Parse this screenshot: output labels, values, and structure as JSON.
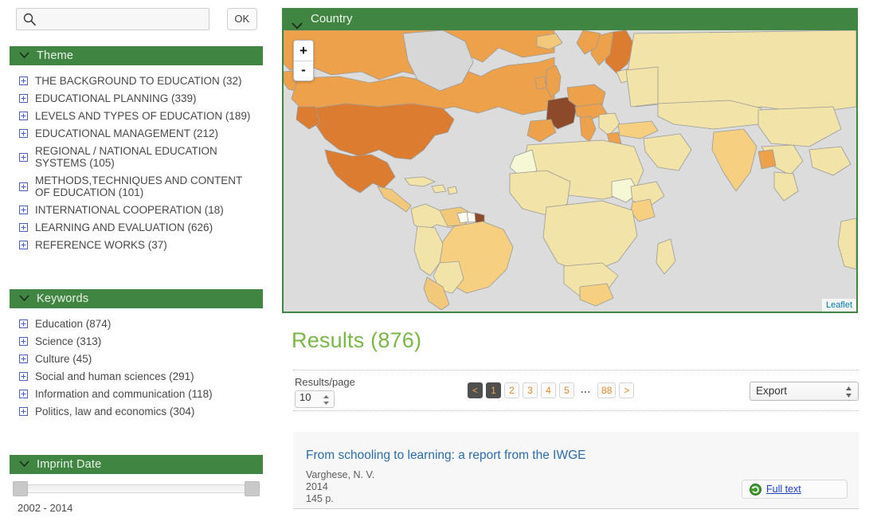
{
  "search": {
    "placeholder": "",
    "value": "",
    "icon": "search-icon",
    "ok_label": "OK"
  },
  "sidebar": {
    "facets": [
      {
        "title": "Theme",
        "icon": "chevron-down-icon",
        "items": [
          {
            "label": "THE BACKGROUND TO EDUCATION (32)"
          },
          {
            "label": "EDUCATIONAL PLANNING (339)"
          },
          {
            "label": "LEVELS AND TYPES OF EDUCATION (189)"
          },
          {
            "label": "EDUCATIONAL MANAGEMENT (212)"
          },
          {
            "label": "REGIONAL / NATIONAL EDUCATION SYSTEMS (105)"
          },
          {
            "label": "METHODS,TECHNIQUES AND CONTENT OF EDUCATION (101)"
          },
          {
            "label": "INTERNATIONAL COOPERATION (18)"
          },
          {
            "label": "LEARNING AND EVALUATION (626)"
          },
          {
            "label": "REFERENCE WORKS (37)"
          }
        ]
      },
      {
        "title": "Keywords",
        "icon": "chevron-down-icon",
        "items": [
          {
            "label": "Education (874)"
          },
          {
            "label": "Science (313)"
          },
          {
            "label": "Culture (45)"
          },
          {
            "label": "Social and human sciences (291)"
          },
          {
            "label": "Information and communication (118)"
          },
          {
            "label": "Politics, law and economics (304)"
          }
        ]
      }
    ],
    "imprint": {
      "title": "Imprint Date",
      "icon": "chevron-down-icon",
      "range_label": "2002 - 2014",
      "min": 2002,
      "max": 2014
    }
  },
  "map": {
    "title": "Country",
    "icon": "chevron-down-icon",
    "zoom_in_label": "+",
    "zoom_out_label": "-",
    "attribution": "Leaflet",
    "colors": {
      "header_green": "#418542",
      "ocean": "#dcdcdc",
      "level0": "#f6f7d4",
      "level1": "#f2e3a8",
      "level2": "#f6d080",
      "level3": "#eda14a",
      "level4": "#dc7c30",
      "level5": "#8c4a2a",
      "border": "#999999"
    }
  },
  "results": {
    "heading": "Results (876)",
    "count": 876,
    "per_page_label": "Results/page",
    "per_page_value": "10",
    "pagination": {
      "prev": "<",
      "next": ">",
      "pages": [
        "1",
        "2",
        "3",
        "4",
        "5"
      ],
      "ellipsis": "...",
      "last": "88",
      "current": "1"
    },
    "export_label": "Export",
    "items": [
      {
        "title": "From schooling to learning: a report from the IWGE",
        "author": "Varghese, N. V.",
        "year": "2014",
        "pages": "145 p.",
        "fulltext_label": "Full text",
        "fulltext_icon": "green-circle-arrow-icon"
      }
    ]
  }
}
